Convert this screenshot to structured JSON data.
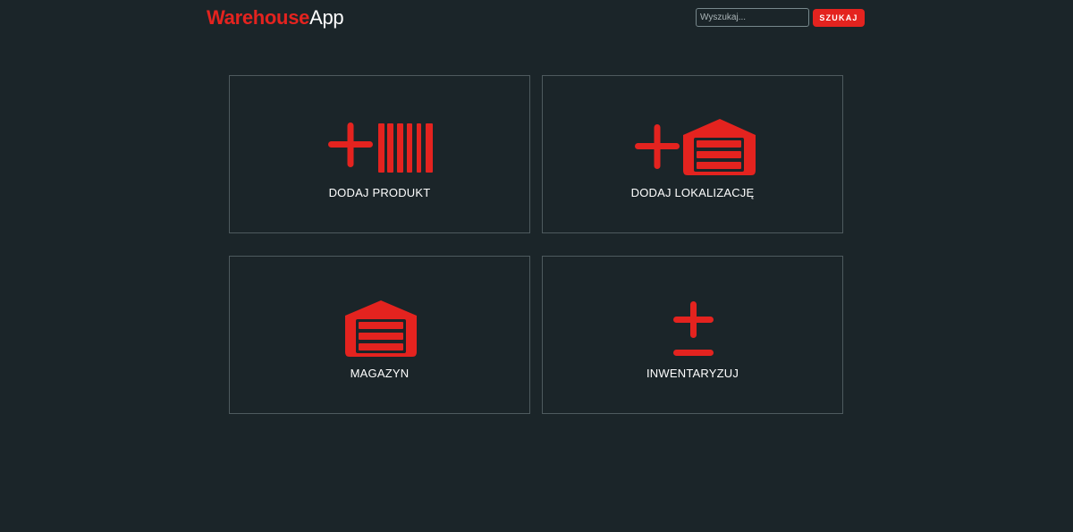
{
  "header": {
    "brand_part1": "Warehouse",
    "brand_part2": "App"
  },
  "search": {
    "placeholder": "Wyszukaj...",
    "button_label": "SZUKAJ"
  },
  "tiles": [
    {
      "label": "DODAJ PRODUKT",
      "icon": "add-barcode-icon"
    },
    {
      "label": "DODAJ LOKALIZACJĘ",
      "icon": "add-warehouse-icon"
    },
    {
      "label": "MAGAZYN",
      "icon": "warehouse-icon"
    },
    {
      "label": "INWENTARYZUJ",
      "icon": "plus-minus-icon"
    }
  ],
  "colors": {
    "background": "#1b2529",
    "accent": "#e4231f",
    "tile_border": "#4e5a5e",
    "text": "#ffffff"
  }
}
